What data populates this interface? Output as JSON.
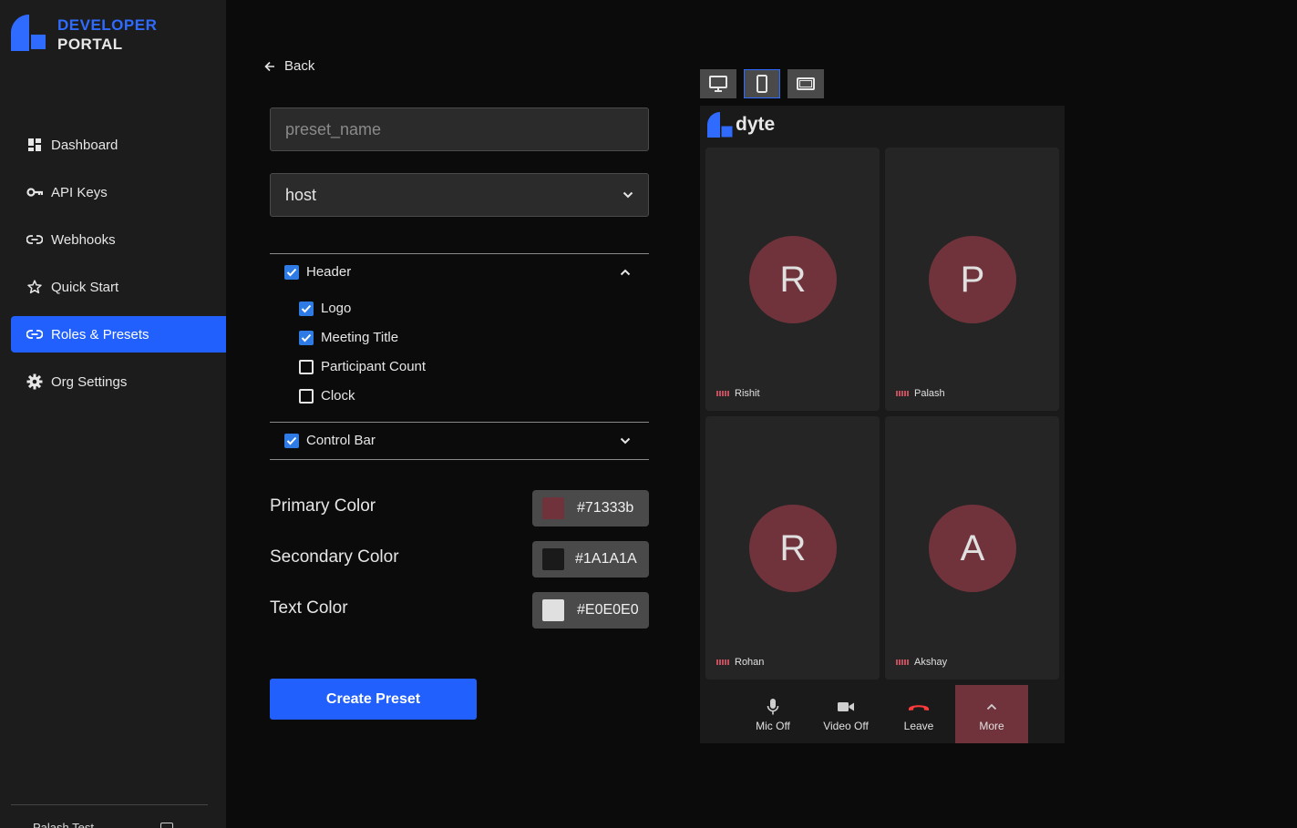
{
  "brand": {
    "line1": "DEVELOPER",
    "line2": "PORTAL",
    "accent": "#2160fd"
  },
  "sidebar": {
    "items": [
      {
        "label": "Dashboard",
        "icon": "dashboard-icon"
      },
      {
        "label": "API Keys",
        "icon": "key-icon"
      },
      {
        "label": "Webhooks",
        "icon": "link-icon"
      },
      {
        "label": "Quick Start",
        "icon": "star-icon"
      },
      {
        "label": "Roles & Presets",
        "icon": "link-icon",
        "active": true
      },
      {
        "label": "Org Settings",
        "icon": "gear-icon"
      }
    ],
    "footer_label": "Palash Test"
  },
  "form": {
    "back_label": "Back",
    "preset_name_placeholder": "preset_name",
    "role_value": "host",
    "header_section": {
      "label": "Header",
      "checked": true,
      "expanded": true,
      "options": [
        {
          "label": "Logo",
          "checked": true
        },
        {
          "label": "Meeting Title",
          "checked": true
        },
        {
          "label": "Participant Count",
          "checked": false
        },
        {
          "label": "Clock",
          "checked": false
        }
      ]
    },
    "control_bar_section": {
      "label": "Control Bar",
      "checked": true,
      "expanded": false
    },
    "colors": {
      "primary": {
        "label": "Primary Color",
        "value": "#71333b"
      },
      "secondary": {
        "label": "Secondary Color",
        "value": "#1A1A1A"
      },
      "text": {
        "label": "Text Color",
        "value": "#E0E0E0"
      }
    },
    "create_label": "Create Preset"
  },
  "preview": {
    "device_modes": [
      "desktop-icon",
      "mobile-icon",
      "tablet-landscape-icon"
    ],
    "selected_device": "mobile",
    "brand_name": "dyte",
    "participants": [
      {
        "initial": "R",
        "name": "Rishit"
      },
      {
        "initial": "P",
        "name": "Palash"
      },
      {
        "initial": "R",
        "name": "Rohan"
      },
      {
        "initial": "A",
        "name": "Akshay"
      }
    ],
    "controls": [
      {
        "label": "Mic Off",
        "icon": "mic-off-icon"
      },
      {
        "label": "Video Off",
        "icon": "video-off-icon"
      },
      {
        "label": "Leave",
        "icon": "phone-hangup-icon"
      },
      {
        "label": "More",
        "icon": "chevron-up-icon"
      }
    ]
  }
}
